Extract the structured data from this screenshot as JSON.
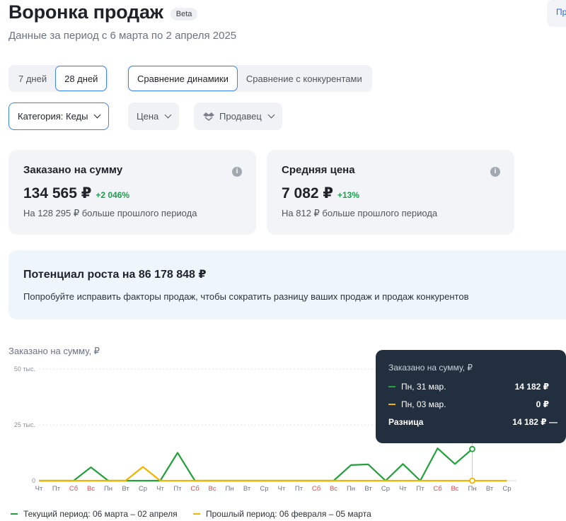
{
  "header": {
    "title": "Воронка продаж",
    "badge": "Beta",
    "subtitle": "Данные за период с 6 марта по 2 апреля 2025",
    "top_right_button": "Пр"
  },
  "period_tabs": [
    {
      "label": "7 дней",
      "active": false
    },
    {
      "label": "28 дней",
      "active": true
    }
  ],
  "compare_tabs": [
    {
      "label": "Сравнение динамики",
      "active": true
    },
    {
      "label": "Сравнение с конкурентами",
      "active": false
    }
  ],
  "filters": {
    "category": "Категория: Кеды",
    "price": "Цена",
    "seller": "Продавец"
  },
  "cards": [
    {
      "title": "Заказано на сумму",
      "value": "134 565 ₽",
      "delta": "+2 046%",
      "note": "На 128 295 ₽ больше прошлого периода"
    },
    {
      "title": "Средняя цена",
      "value": "7 082 ₽",
      "delta": "+13%",
      "note": "На 812 ₽ больше прошлого периода"
    }
  ],
  "potential": {
    "title": "Потенциал роста на 86 178 848 ₽",
    "text": "Попробуйте исправить факторы продаж, чтобы сократить разницу ваших продаж и продаж конкурентов"
  },
  "chart_data": {
    "type": "line",
    "title": "Заказано на сумму, ₽",
    "y_ticks": [
      "0",
      "25 тыс.",
      "50 тыс."
    ],
    "ylim": [
      0,
      50000
    ],
    "x": [
      "Чт",
      "Пт",
      "Сб",
      "Вс",
      "Пн",
      "Вт",
      "Ср",
      "Чт",
      "Пт",
      "Сб",
      "Вс",
      "Пн",
      "Вт",
      "Ср",
      "Чт",
      "Пт",
      "Сб",
      "Вс",
      "Пн",
      "Вт",
      "Ср",
      "Чт",
      "Пт",
      "Сб",
      "Вс",
      "Пн",
      "Вт",
      "Ср"
    ],
    "weekend_indices": [
      2,
      3,
      9,
      10,
      16,
      17,
      23,
      24
    ],
    "series": [
      {
        "name": "Текущий период: 06 марта – 02 апреля",
        "color": "#22a03a",
        "values": [
          0,
          0,
          0,
          6000,
          0,
          0,
          0,
          0,
          12500,
          0,
          0,
          0,
          0,
          0,
          0,
          0,
          0,
          0,
          7000,
          7300,
          0,
          7500,
          0,
          14500,
          7500,
          14182,
          null,
          null
        ]
      },
      {
        "name": "Прошлый период: 06 февраля – 05 марта",
        "color": "#f0b400",
        "values": [
          0,
          0,
          0,
          0,
          0,
          0,
          6200,
          0,
          0,
          0,
          0,
          0,
          0,
          0,
          0,
          0,
          0,
          0,
          0,
          0,
          0,
          0,
          0,
          0,
          0,
          0,
          0,
          0
        ]
      }
    ],
    "highlight_index": 25
  },
  "tooltip": {
    "title": "Заказано на сумму, ₽",
    "rows": [
      {
        "label": "Пн, 31 мар.",
        "value": "14 182 ₽",
        "color": "#22a03a"
      },
      {
        "label": "Пн, 03 мар.",
        "value": "0 ₽",
        "color": "#f0b400"
      }
    ],
    "diff_label": "Разница",
    "diff_value": "14 182 ₽ —"
  },
  "legend": [
    {
      "label": "Текущий период: 06 марта – 02 апреля",
      "color": "#22a03a"
    },
    {
      "label": "Прошлый период: 06 февраля – 05 марта",
      "color": "#f0b400"
    }
  ]
}
